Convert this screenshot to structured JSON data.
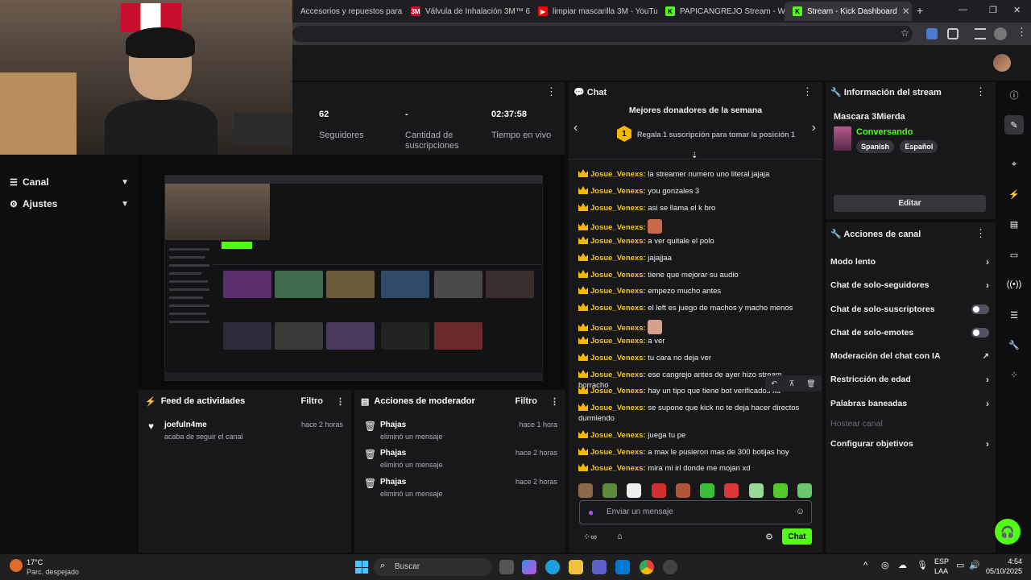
{
  "browser": {
    "tabs": [
      {
        "label": "Accesorios y repuestos para re"
      },
      {
        "label": "Válvula de Inhalación 3M™ 6893"
      },
      {
        "label": "limpiar mascarilla 3M - YouTube"
      },
      {
        "label": "PAPICANGREJO Stream - Watch"
      },
      {
        "label": "Stream - Kick Dashboard"
      }
    ],
    "new_tab": "+",
    "window_controls": {
      "minimize": "—",
      "maximize": "❐",
      "close": "✕"
    }
  },
  "stats": {
    "items": [
      {
        "value": "62",
        "label": "Seguidores"
      },
      {
        "value": "-",
        "label": "Cantidad de suscripciones"
      },
      {
        "value": "02:37:58",
        "label": "Tiempo en vivo"
      }
    ]
  },
  "nav": {
    "items": [
      {
        "label": "Canal",
        "icon": "list-icon"
      },
      {
        "label": "Ajustes",
        "icon": "gear-icon"
      }
    ]
  },
  "activity_feed": {
    "title": "Feed de actividades",
    "filter": "Filtro",
    "items": [
      {
        "name": "joefuln4me",
        "action": "acaba de seguir el canal",
        "time": "hace 2 horas"
      }
    ]
  },
  "mod_actions": {
    "title": "Acciones de moderador",
    "filter": "Filtro",
    "items": [
      {
        "name": "Phajas",
        "action": "eliminó un mensaje",
        "time": "hace 1 hora"
      },
      {
        "name": "Phajas",
        "action": "eliminó un mensaje",
        "time": "hace 2 horas"
      },
      {
        "name": "Phajas",
        "action": "eliminó un mensaje",
        "time": "hace 2 horas"
      }
    ]
  },
  "chat": {
    "title": "Chat",
    "donors_title": "Mejores donadores de la semana",
    "donors_rank": "1",
    "donors_text": "Regala 1 suscripción para tomar la posición 1",
    "messages": [
      {
        "user": "Josue_Venexs:",
        "text": "la streamer numero uno literal jajaja"
      },
      {
        "user": "Josue_Venexs:",
        "text": "you gonzales 3"
      },
      {
        "user": "Josue_Venexs:",
        "text": "asi se llama el k bro"
      },
      {
        "user": "Josue_Venexs:",
        "text": ""
      },
      {
        "user": "Josue_Venexs:",
        "text": "a ver quitale el polo"
      },
      {
        "user": "Josue_Venexs:",
        "text": "jajajjaa"
      },
      {
        "user": "Josue_Venexs:",
        "text": "tiene que mejorar su audio"
      },
      {
        "user": "Josue_Venexs:",
        "text": "empezo mucho antes"
      },
      {
        "user": "Josue_Venexs:",
        "text": "el left es juego de machos y macho menos"
      },
      {
        "user": "Josue_Venexs:",
        "text": ""
      },
      {
        "user": "Josue_Venexs:",
        "text": "a ver"
      },
      {
        "user": "Josue_Venexs:",
        "text": "tu cara no deja ver"
      },
      {
        "user": "Josue_Venexs:",
        "text": "ese cangrejo antes de ayer hizo stream borracho"
      },
      {
        "user": "Josue_Venexs:",
        "text": "hay un tipo que tiene bot verificados xd"
      },
      {
        "user": "Josue_Venexs:",
        "text": "se supone que kick no te deja hacer directos durmiendo"
      },
      {
        "user": "Josue_Venexs:",
        "text": "juega tu pe"
      },
      {
        "user": "Josue_Venexs:",
        "text": "a max le pusieron mas de 300 botijas hoy"
      },
      {
        "user": "Josue_Venexs:",
        "text": "mira mi irl donde me mojan xd"
      }
    ],
    "input_placeholder": "Enviar un mensaje",
    "send_label": "Chat"
  },
  "stream_info": {
    "title": "Información del stream",
    "stream_title": "Mascara 3Mierda",
    "category": "Conversando",
    "tags": [
      "Spanish",
      "Español"
    ],
    "edit_label": "Editar"
  },
  "channel_actions": {
    "title": "Acciones de canal",
    "items": [
      {
        "label": "Modo lento",
        "control": "chevron"
      },
      {
        "label": "Chat de solo-seguidores",
        "control": "chevron"
      },
      {
        "label": "Chat de solo-suscriptores",
        "control": "toggle"
      },
      {
        "label": "Chat de solo-emotes",
        "control": "toggle"
      },
      {
        "label": "Moderación del chat con IA",
        "control": "external"
      },
      {
        "label": "Restricción de edad",
        "control": "chevron"
      },
      {
        "label": "Palabras baneadas",
        "control": "chevron"
      },
      {
        "label": "Hostear canal",
        "control": "none"
      },
      {
        "label": "Configurar objetivos",
        "control": "chevron"
      }
    ]
  },
  "taskbar": {
    "weather_temp": "17°C",
    "weather_desc": "Parc. despejado",
    "search_placeholder": "Buscar",
    "lang": "ESP",
    "lang2": "LAA",
    "time": "4:54",
    "date": "05/10/2025"
  },
  "colors": {
    "accent": "#53fc18",
    "badge": "#f5b800",
    "username": "#f5c518",
    "panel": "#18181b",
    "background": "#0e0e10"
  }
}
